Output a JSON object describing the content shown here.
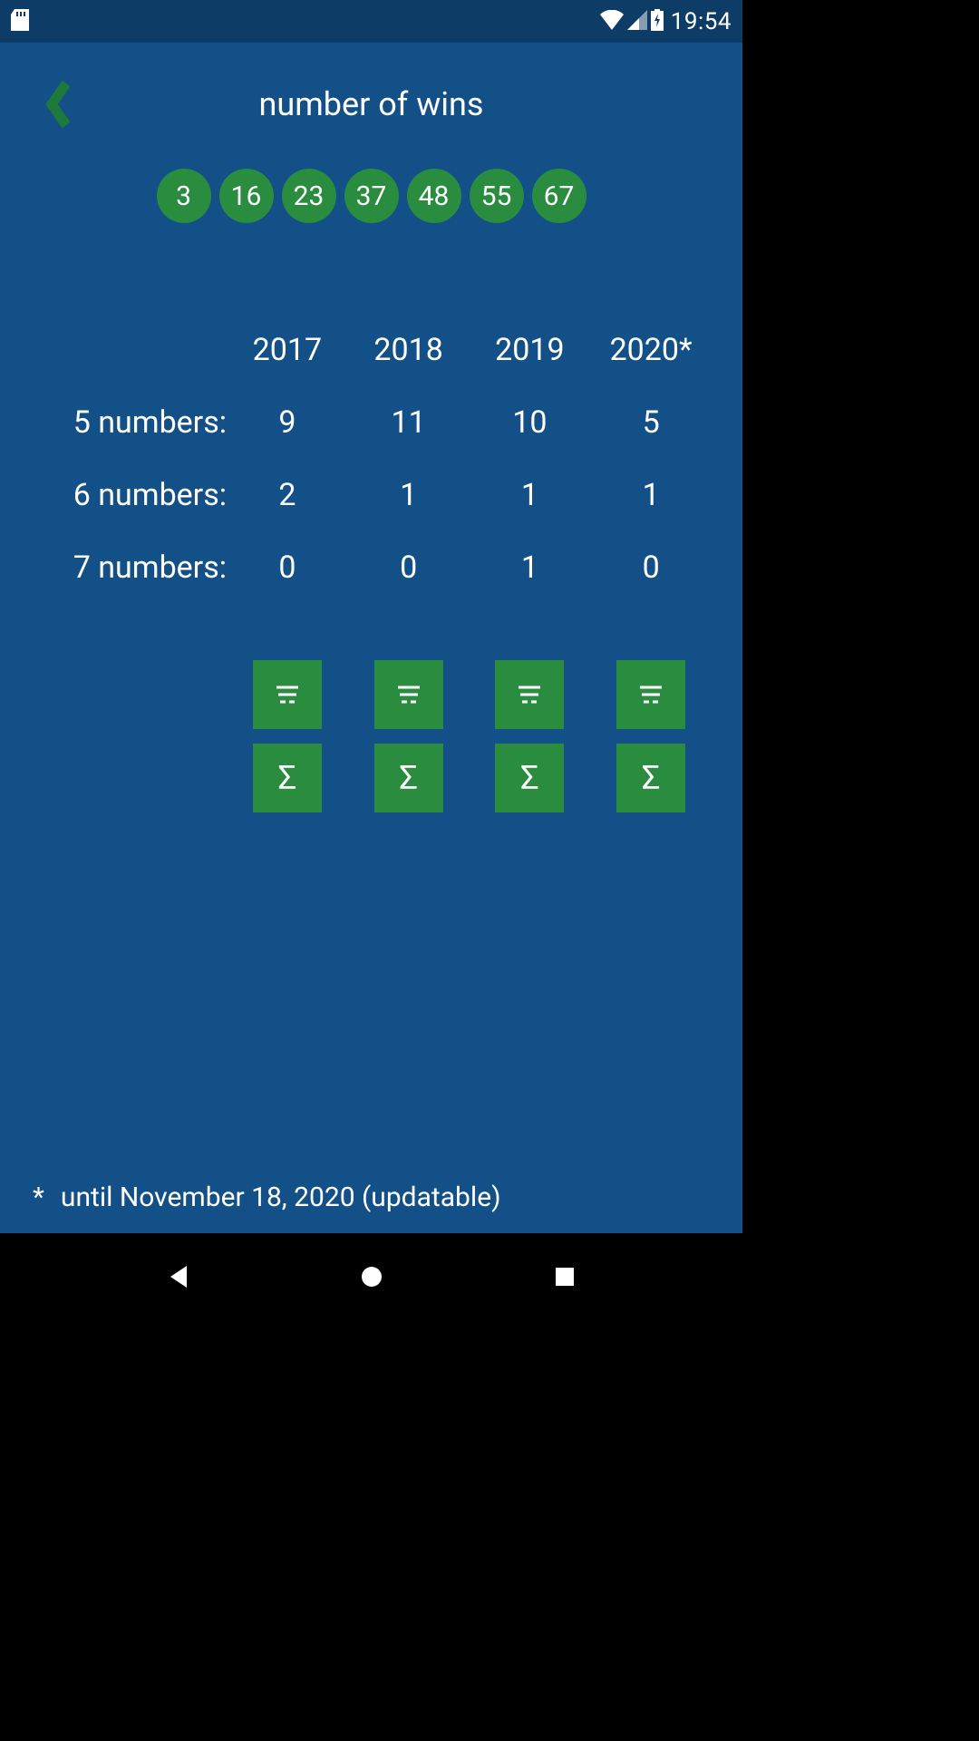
{
  "status": {
    "clock": "19:54"
  },
  "header": {
    "title": "number of wins"
  },
  "balls": [
    "3",
    "16",
    "23",
    "37",
    "48",
    "55",
    "67"
  ],
  "years": [
    "2017",
    "2018",
    "2019",
    "2020*"
  ],
  "rows": [
    {
      "label": "5 numbers:",
      "values": [
        "9",
        "11",
        "10",
        "5"
      ]
    },
    {
      "label": "6 numbers:",
      "values": [
        "2",
        "1",
        "1",
        "1"
      ]
    },
    {
      "label": "7 numbers:",
      "values": [
        "0",
        "0",
        "1",
        "0"
      ]
    }
  ],
  "footnote": {
    "mark": "*",
    "text": "until November 18, 2020 (updatable)"
  }
}
